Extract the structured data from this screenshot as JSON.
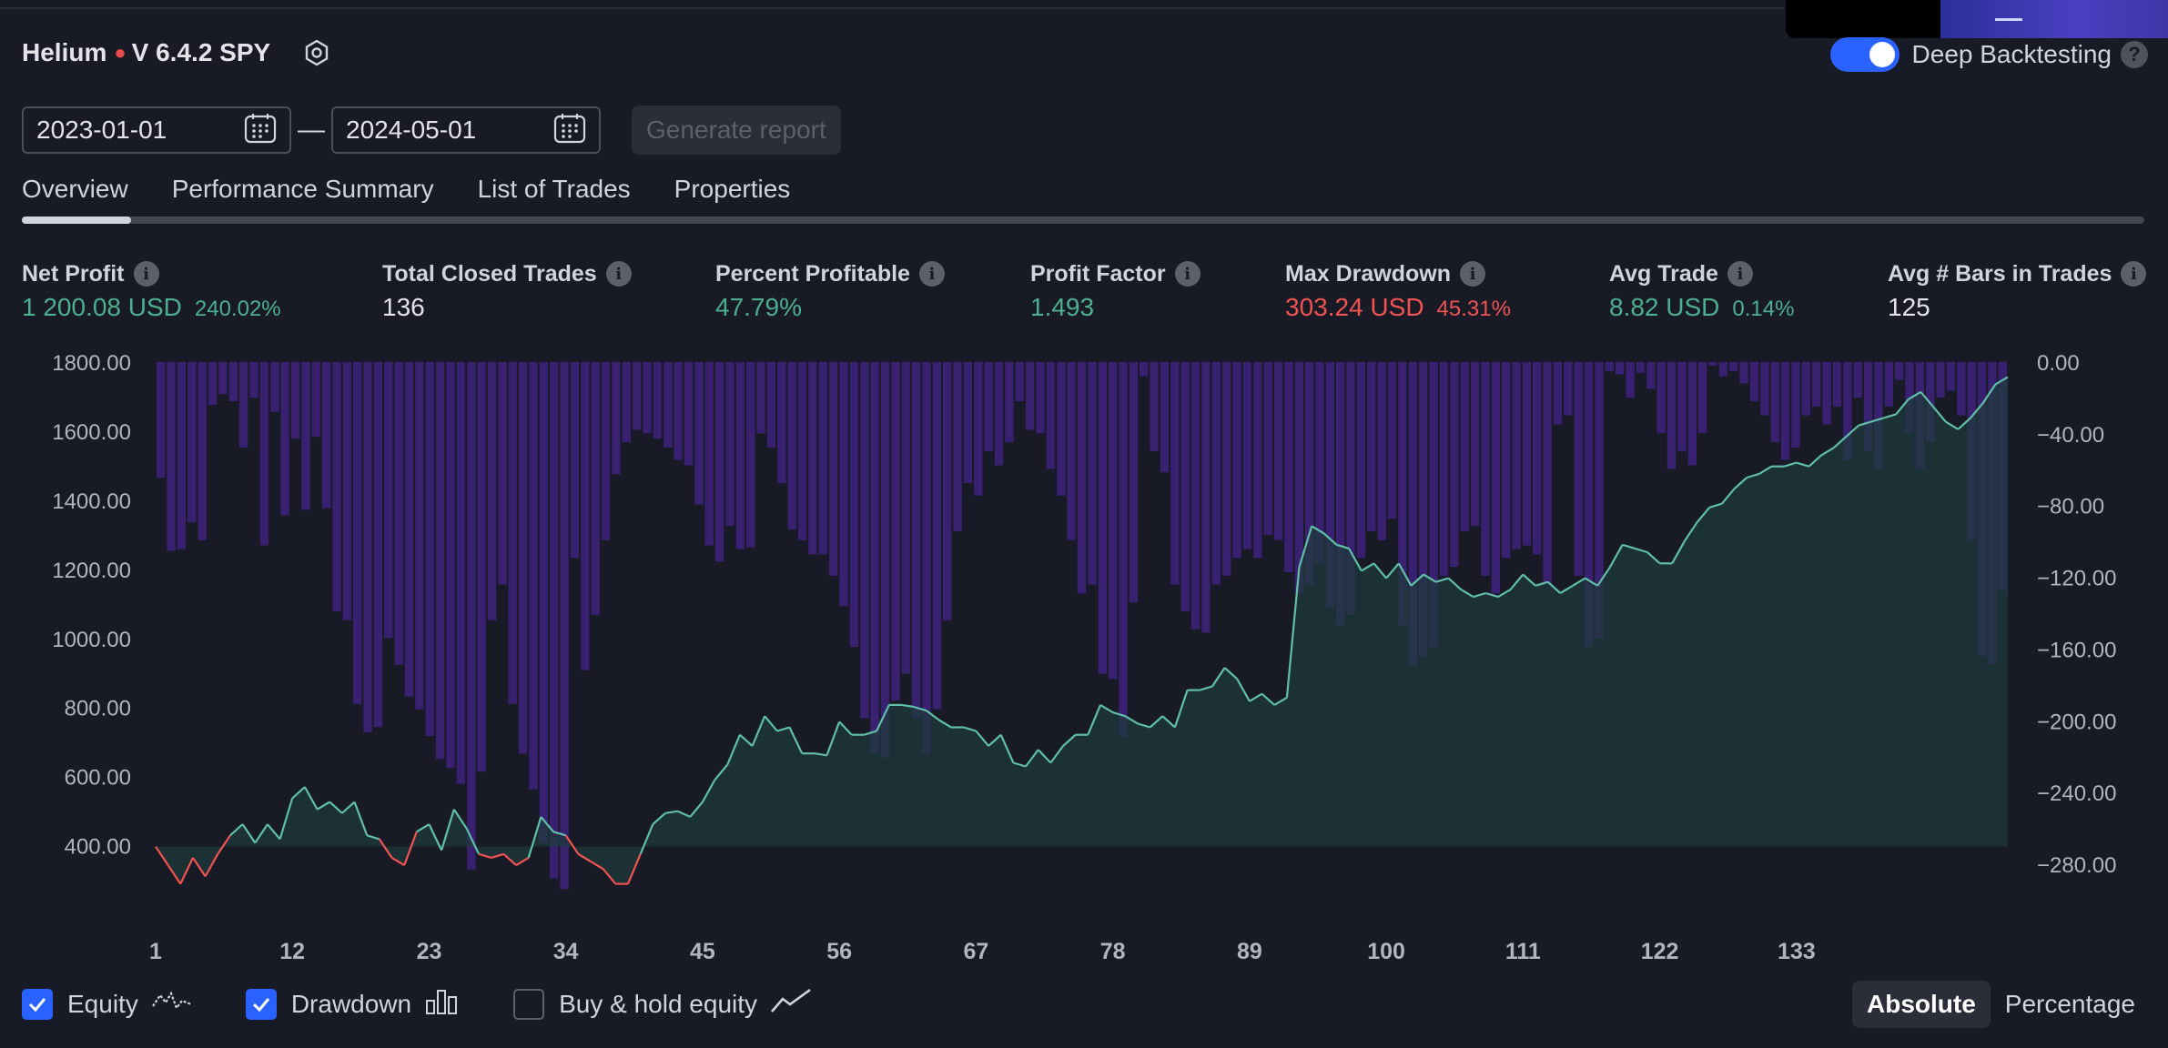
{
  "header": {
    "strategy_name": "Helium",
    "version_symbol": "V 6.4.2 SPY"
  },
  "deep_backtesting": {
    "label": "Deep Backtesting",
    "enabled": true,
    "help": "?"
  },
  "dates": {
    "start": "2023-01-01",
    "end": "2024-05-01",
    "separator": "—"
  },
  "generate_button": "Generate report",
  "tabs": [
    {
      "label": "Overview",
      "active": true
    },
    {
      "label": "Performance Summary"
    },
    {
      "label": "List of Trades"
    },
    {
      "label": "Properties"
    }
  ],
  "stats": {
    "net_profit": {
      "label": "Net Profit",
      "value": "1 200.08 USD",
      "pct": "240.02%"
    },
    "total_closed_trades": {
      "label": "Total Closed Trades",
      "value": "136"
    },
    "percent_profitable": {
      "label": "Percent Profitable",
      "value": "47.79%"
    },
    "profit_factor": {
      "label": "Profit Factor",
      "value": "1.493"
    },
    "max_drawdown": {
      "label": "Max Drawdown",
      "value": "303.24 USD",
      "pct": "45.31%"
    },
    "avg_trade": {
      "label": "Avg Trade",
      "value": "8.82 USD",
      "pct": "0.14%"
    },
    "avg_bars": {
      "label": "Avg # Bars in Trades",
      "value": "125"
    }
  },
  "chart_data": {
    "type": "line",
    "equity_baseline": 500,
    "left_axis": {
      "ticks": [
        "1800.00",
        "1600.00",
        "1400.00",
        "1200.00",
        "1000.00",
        "800.00",
        "600.00",
        "400.00"
      ],
      "range": [
        360,
        1800
      ]
    },
    "right_axis": {
      "ticks": [
        "0.00",
        "−40.00",
        "−80.00",
        "−120.00",
        "−160.00",
        "−200.00",
        "−240.00",
        "−280.00"
      ],
      "range": [
        0,
        -280
      ]
    },
    "x_ticks": [
      "1",
      "12",
      "23",
      "34",
      "45",
      "56",
      "67",
      "78",
      "89",
      "100",
      "111",
      "122",
      "133"
    ],
    "equity": {
      "name": "Equity",
      "x": [
        1,
        2,
        3,
        4,
        5,
        6,
        7,
        8,
        9,
        10,
        11,
        12,
        13,
        14,
        15,
        16,
        17,
        18,
        19,
        20,
        21,
        22,
        23,
        24,
        25,
        26,
        27,
        28,
        29,
        30,
        31,
        32,
        33,
        34,
        35,
        36,
        37,
        38,
        39,
        40,
        41,
        42,
        43,
        44,
        45,
        46,
        47,
        48,
        49,
        50,
        51,
        52,
        53,
        54,
        55,
        56,
        57,
        58,
        59,
        60,
        61,
        62,
        63,
        64,
        65,
        66,
        67,
        68,
        69,
        70,
        71,
        72,
        73,
        74,
        75,
        76,
        77,
        78,
        79,
        80,
        81,
        82,
        83,
        84,
        85,
        86,
        87,
        88,
        89,
        90,
        91,
        92,
        93,
        94,
        95,
        96,
        97,
        98,
        99,
        100,
        101,
        102,
        103,
        104,
        105,
        106,
        107,
        108,
        109,
        110,
        111,
        112,
        113,
        114,
        115,
        116,
        117,
        118,
        119,
        120,
        121,
        122,
        123,
        124,
        125,
        126,
        127,
        128,
        129,
        130,
        131,
        132,
        133,
        134,
        135,
        136
      ],
      "values": [
        500,
        450,
        400,
        470,
        420,
        480,
        530,
        560,
        510,
        560,
        520,
        630,
        660,
        600,
        620,
        590,
        620,
        530,
        520,
        470,
        450,
        540,
        560,
        490,
        600,
        550,
        480,
        470,
        480,
        450,
        470,
        580,
        540,
        530,
        480,
        460,
        440,
        400,
        400,
        480,
        560,
        590,
        595,
        580,
        620,
        680,
        720,
        800,
        770,
        850,
        810,
        820,
        750,
        750,
        745,
        835,
        800,
        800,
        810,
        880,
        880,
        875,
        865,
        840,
        820,
        820,
        810,
        770,
        800,
        725,
        715,
        760,
        725,
        770,
        800,
        800,
        880,
        860,
        850,
        830,
        820,
        850,
        820,
        920,
        920,
        930,
        980,
        950,
        890,
        910,
        880,
        900,
        1250,
        1360,
        1340,
        1310,
        1300,
        1240,
        1260,
        1220,
        1260,
        1200,
        1230,
        1210,
        1220,
        1190,
        1170,
        1180,
        1170,
        1190,
        1230,
        1200,
        1210,
        1180,
        1200,
        1220,
        1200,
        1250,
        1310,
        1300,
        1290,
        1260,
        1260,
        1320,
        1370,
        1410,
        1420,
        1460,
        1490,
        1500,
        1520,
        1520,
        1530,
        1520,
        1550,
        1570,
        1600,
        1630,
        1640,
        1650,
        1660,
        1700,
        1720,
        1680,
        1640,
        1620,
        1650,
        1690,
        1740,
        1760
      ]
    },
    "drawdown": {
      "name": "Drawdown",
      "values": [
        -65,
        -106,
        -105,
        -90,
        -100,
        -24,
        -18,
        -22,
        -48,
        -20,
        -103,
        -28,
        -86,
        -43,
        -83,
        -42,
        -82,
        -140,
        -145,
        -192,
        -208,
        -205,
        -155,
        -170,
        -188,
        -195,
        -210,
        -223,
        -228,
        -237,
        -285,
        -230,
        -145,
        -125,
        -192,
        -220,
        -240,
        -270,
        -290,
        -296,
        -110,
        -173,
        -142,
        -100,
        -63,
        -45,
        -38,
        -40,
        -43,
        -48,
        -55,
        -58,
        -80,
        -103,
        -112,
        -92,
        -105,
        -104,
        -40,
        -48,
        -68,
        -94,
        -100,
        -108,
        -108,
        -120,
        -137,
        -160,
        -200,
        -220,
        -222,
        -190,
        -175,
        -200,
        -220,
        -195,
        -145,
        -95,
        -68,
        -75,
        -50,
        -58,
        -45,
        -22,
        -38,
        -40,
        -60,
        -75,
        -100,
        -130,
        -125,
        -175,
        -178,
        -210,
        -135,
        -8,
        -50,
        -62,
        -125,
        -140,
        -150,
        -152,
        -125,
        -120,
        -110,
        -105,
        -110,
        -97,
        -100,
        -118,
        -130,
        -125,
        -113,
        -138,
        -148,
        -142,
        -110,
        -95,
        -100,
        -88,
        -148,
        -170,
        -165,
        -160,
        -120,
        -115,
        -95,
        -92,
        -120,
        -130,
        -110,
        -105,
        -103,
        -108,
        -125,
        -35,
        -30,
        -120,
        -160,
        -155,
        -5,
        -7,
        -20,
        -6,
        -15,
        -40,
        -60,
        -50,
        -58,
        -40,
        -2,
        -8,
        -5,
        -12,
        -22,
        -30,
        -45,
        -55,
        -48,
        -30,
        -25,
        -35,
        -25,
        -55,
        -20,
        -50,
        -60,
        -25,
        -10,
        -40,
        -60,
        -45,
        -20,
        -16,
        -30,
        -100,
        -165,
        -170,
        -128
      ]
    },
    "legend": [
      {
        "label": "Equity",
        "checked": true
      },
      {
        "label": "Drawdown",
        "checked": true
      },
      {
        "label": "Buy & hold equity",
        "checked": false
      }
    ]
  },
  "modes": {
    "absolute": "Absolute",
    "percentage": "Percentage",
    "active": "absolute"
  },
  "colors": {
    "accent": "#2962ff",
    "profit": "#4caf8f",
    "loss": "#f05350",
    "drawdown": "#4a2a8c"
  }
}
